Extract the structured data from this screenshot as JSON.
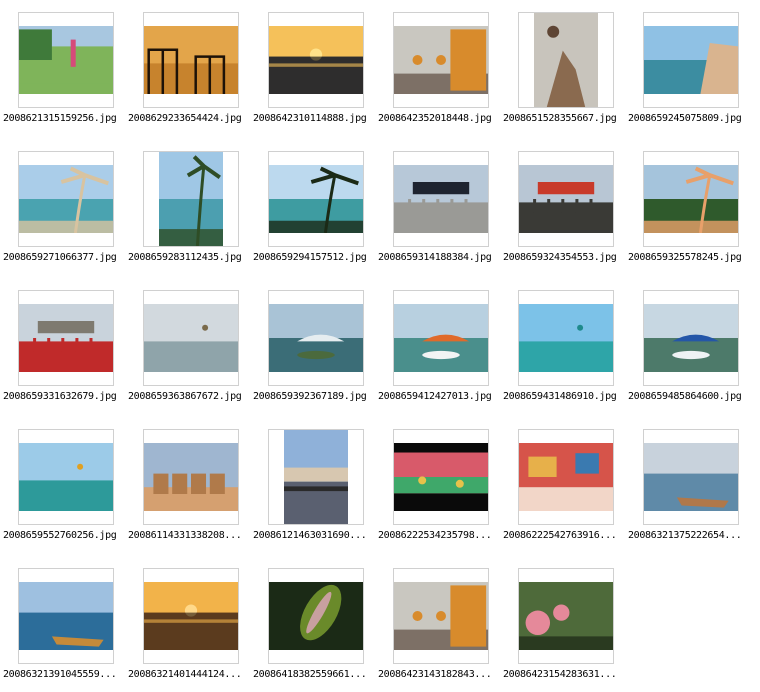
{
  "files": [
    {
      "name": "2008621315159256.jpg",
      "thumb": "landscape",
      "scene": "girl-skateboard-park",
      "colors": [
        "#a8c7e0",
        "#3f7a3a",
        "#7fb45a",
        "#d9d3c9"
      ]
    },
    {
      "name": "2008629233654424.jpg",
      "thumb": "landscape",
      "scene": "sunset-railing-silhouette",
      "colors": [
        "#e3a54a",
        "#c7832d",
        "#1d1208",
        "#f0c46a"
      ]
    },
    {
      "name": "2008642310114888.jpg",
      "thumb": "landscape",
      "scene": "sunset-lake-reflection",
      "colors": [
        "#f5c15a",
        "#5c5a5e",
        "#1b1a18",
        "#ffe38a"
      ]
    },
    {
      "name": "2008642352018448.jpg",
      "thumb": "landscape",
      "scene": "workers-wooden-boat",
      "colors": [
        "#c9c7c0",
        "#7d7066",
        "#d88b2c",
        "#2d6aa3"
      ]
    },
    {
      "name": "2008651528355667.jpg",
      "thumb": "portrait",
      "scene": "driftwood-rooster-sculpture",
      "colors": [
        "#c8c4bc",
        "#8a6a4f",
        "#5e4534",
        "#b9b3aa"
      ]
    },
    {
      "name": "2008659245075809.jpg",
      "thumb": "landscape",
      "scene": "sea-rocks",
      "colors": [
        "#8fc1e4",
        "#3c8da1",
        "#d9b48f",
        "#c9a27d"
      ]
    },
    {
      "name": "2008659271066377.jpg",
      "thumb": "landscape",
      "scene": "beach-tree-branches",
      "colors": [
        "#aacde9",
        "#4aa3b0",
        "#d8c3a0",
        "#1e3a1e"
      ]
    },
    {
      "name": "2008659283112435.jpg",
      "thumb": "portrait",
      "scene": "palm-trees-sea",
      "colors": [
        "#9fc7e5",
        "#4c9fb0",
        "#2e4d26",
        "#d7c59a"
      ]
    },
    {
      "name": "2008659294157512.jpg",
      "thumb": "landscape",
      "scene": "palm-leaves-sea-boat",
      "colors": [
        "#bcd9ee",
        "#3e9ca1",
        "#1b2a16",
        "#cde4ef"
      ]
    },
    {
      "name": "2008659314188384.jpg",
      "thumb": "landscape",
      "scene": "ceremony-red-banner",
      "colors": [
        "#b7c8d8",
        "#c62a2a",
        "#9a9a96",
        "#1e2430"
      ]
    },
    {
      "name": "2008659324354553.jpg",
      "thumb": "landscape",
      "scene": "street-crowd-parade",
      "colors": [
        "#b8c6d4",
        "#8a8a86",
        "#3a3a36",
        "#c83a2a"
      ]
    },
    {
      "name": "2008659325578245.jpg",
      "thumb": "landscape",
      "scene": "palm-beach-people",
      "colors": [
        "#a5c4dc",
        "#2f5a2c",
        "#e8a06a",
        "#4aa6aa"
      ]
    },
    {
      "name": "2008659331632679.jpg",
      "thumb": "landscape",
      "scene": "truck-street",
      "colors": [
        "#c9d3dc",
        "#2b3a5a",
        "#c02a2a",
        "#7e7a70"
      ]
    },
    {
      "name": "2008659363867672.jpg",
      "thumb": "landscape",
      "scene": "grey-sea-boats",
      "colors": [
        "#d2d9de",
        "#8fa4aa",
        "#5d6e70",
        "#7a6a4a"
      ]
    },
    {
      "name": "2008659392367189.jpg",
      "thumb": "landscape",
      "scene": "jetski-island",
      "colors": [
        "#a9c3d6",
        "#3b6d77",
        "#e6edf0",
        "#4b6a3d"
      ]
    },
    {
      "name": "2008659412427013.jpg",
      "thumb": "landscape",
      "scene": "speedboat-wave",
      "colors": [
        "#b8d0e0",
        "#4a8f8c",
        "#e06a2a",
        "#f2f4f4"
      ]
    },
    {
      "name": "2008659431486910.jpg",
      "thumb": "landscape",
      "scene": "calm-sea-sky",
      "colors": [
        "#7cc2e8",
        "#2ea5a8",
        "#d4ecf5",
        "#1e8a8c"
      ]
    },
    {
      "name": "2008659485864600.jpg",
      "thumb": "landscape",
      "scene": "speedboat-island",
      "colors": [
        "#c7d7e2",
        "#4d7a6a",
        "#2456a8",
        "#eef2f4"
      ]
    },
    {
      "name": "2008659552760256.jpg",
      "thumb": "landscape",
      "scene": "parasail-sea",
      "colors": [
        "#9ccbe8",
        "#2d9a9a",
        "#c8e2ef",
        "#e0a020"
      ]
    },
    {
      "name": "20086114331338208...",
      "thumb": "landscape",
      "scene": "grain-silos",
      "colors": [
        "#9fb6d0",
        "#b07a4a",
        "#d5a070",
        "#6a4a30"
      ]
    },
    {
      "name": "20086121463031690...",
      "thumb": "portrait",
      "scene": "dusk-river-trees",
      "colors": [
        "#8fb1d9",
        "#d7c7b0",
        "#2a2a2a",
        "#5a6070"
      ]
    },
    {
      "name": "20086222534235798...",
      "thumb": "landscape",
      "scene": "stage-performance",
      "colors": [
        "#0a0a0a",
        "#d85a6a",
        "#3fa86a",
        "#e7c24a"
      ]
    },
    {
      "name": "20086222542763916...",
      "thumb": "landscape",
      "scene": "children-red-stage",
      "colors": [
        "#d6544a",
        "#e7b04a",
        "#f2d6c8",
        "#3a7ab0"
      ]
    },
    {
      "name": "20086321375222654...",
      "thumb": "landscape",
      "scene": "harbor-boat-dusk",
      "colors": [
        "#c8d2dc",
        "#5f8aa8",
        "#b0784a",
        "#2a3a48"
      ]
    },
    {
      "name": "20086321391045559...",
      "thumb": "landscape",
      "scene": "harbor-many-boats",
      "colors": [
        "#9ec0e0",
        "#2c6d9a",
        "#c58a3a",
        "#5a4a3a"
      ]
    },
    {
      "name": "20086321401444124...",
      "thumb": "landscape",
      "scene": "golden-sea-sunset",
      "colors": [
        "#f2b34a",
        "#a8642a",
        "#3a2a1a",
        "#ffd98a"
      ]
    },
    {
      "name": "20086418382559661...",
      "thumb": "landscape",
      "scene": "leaf-macro",
      "colors": [
        "#1b2a16",
        "#6a8a2a",
        "#c8a0a0",
        "#0e140c"
      ]
    },
    {
      "name": "20086423143182843...",
      "thumb": "landscape",
      "scene": "workers-wooden-boat",
      "colors": [
        "#c9c7c0",
        "#7d7066",
        "#d88b2c",
        "#2d6aa3"
      ]
    },
    {
      "name": "20086423154283631...",
      "thumb": "landscape",
      "scene": "pink-flowers",
      "colors": [
        "#4e6a3a",
        "#e5899a",
        "#8aa468",
        "#2a3a20"
      ]
    }
  ]
}
